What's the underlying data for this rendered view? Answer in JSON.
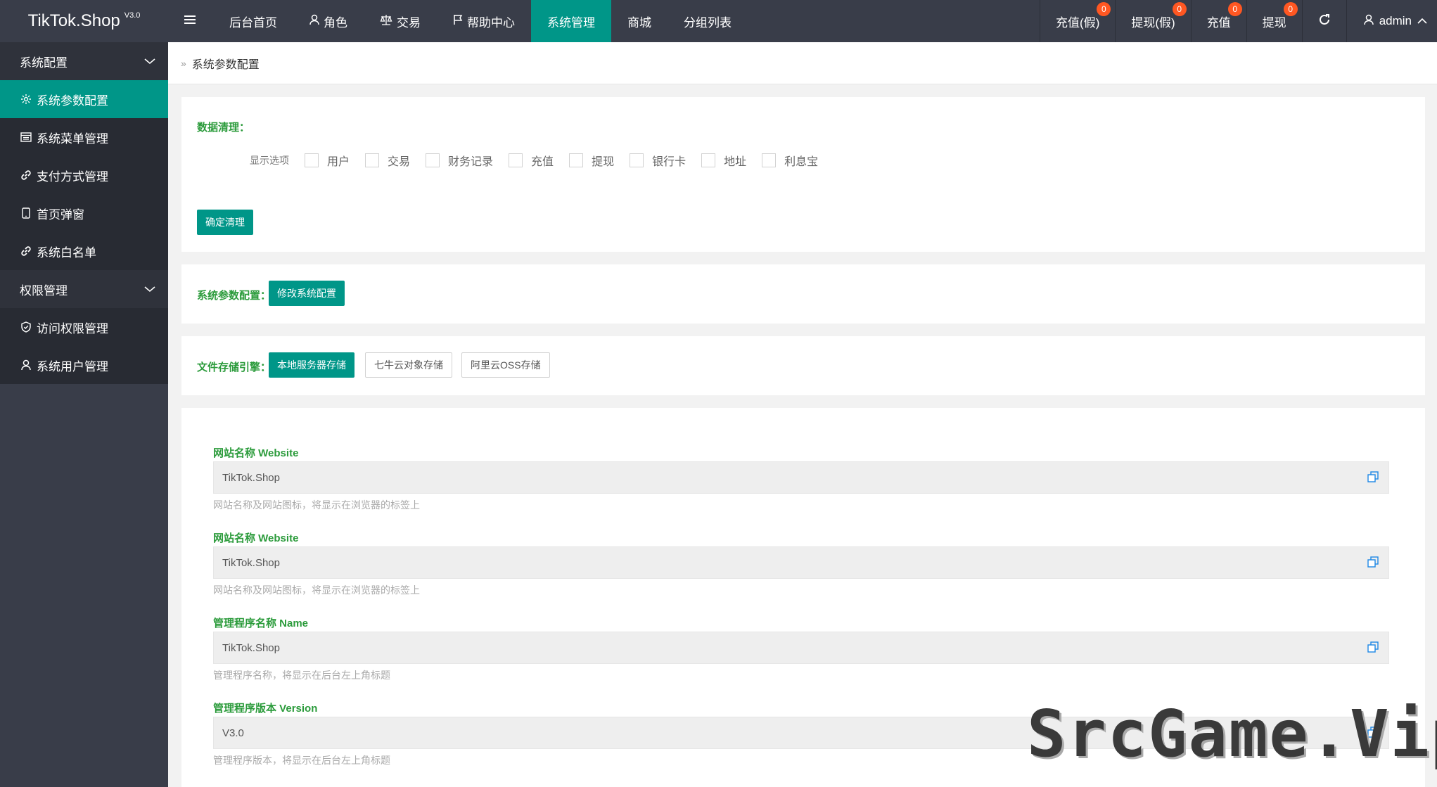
{
  "brand": {
    "name": "TikTok.Shop",
    "version": "V3.0"
  },
  "topnav": {
    "items": [
      {
        "label": "后台首页",
        "icon": ""
      },
      {
        "label": "角色",
        "icon": "user-icon"
      },
      {
        "label": "交易",
        "icon": "scale-icon"
      },
      {
        "label": "帮助中心",
        "icon": "flag-icon"
      },
      {
        "label": "系统管理",
        "icon": "",
        "active": true
      },
      {
        "label": "商城",
        "icon": ""
      },
      {
        "label": "分组列表",
        "icon": ""
      }
    ],
    "right": [
      {
        "label": "充值(假)",
        "badge": "0"
      },
      {
        "label": "提现(假)",
        "badge": "0"
      },
      {
        "label": "充值",
        "badge": "0"
      },
      {
        "label": "提现",
        "badge": "0"
      }
    ],
    "user": "admin"
  },
  "sidebar": {
    "groups": [
      {
        "label": "系统配置",
        "items": [
          {
            "label": "系统参数配置",
            "icon": "gear-icon",
            "active": true
          },
          {
            "label": "系统菜单管理",
            "icon": "window-icon"
          },
          {
            "label": "支付方式管理",
            "icon": "link-icon"
          },
          {
            "label": "首页弹窗",
            "icon": "phone-icon"
          },
          {
            "label": "系统白名单",
            "icon": "link-icon"
          }
        ]
      },
      {
        "label": "权限管理",
        "items": [
          {
            "label": "访问权限管理",
            "icon": "shield-icon"
          },
          {
            "label": "系统用户管理",
            "icon": "user-icon"
          }
        ]
      }
    ]
  },
  "breadcrumb": {
    "current": "系统参数配置"
  },
  "data_clean": {
    "title": "数据清理：",
    "display_label": "显示选项",
    "options": [
      "用户",
      "交易",
      "财务记录",
      "充值",
      "提现",
      "银行卡",
      "地址",
      "利息宝"
    ],
    "confirm_button": "确定清理"
  },
  "system_params": {
    "title": "系统参数配置：",
    "button": "修改系统配置"
  },
  "storage": {
    "title": "文件存储引擎：",
    "options": [
      "本地服务器存储",
      "七牛云对象存储",
      "阿里云OSS存储"
    ],
    "selected": "本地服务器存储"
  },
  "fields": [
    {
      "label": "网站名称 Website",
      "value": "TikTok.Shop",
      "help": "网站名称及网站图标，将显示在浏览器的标签上"
    },
    {
      "label": "网站名称 Website",
      "value": "TikTok.Shop",
      "help": "网站名称及网站图标，将显示在浏览器的标签上"
    },
    {
      "label": "管理程序名称 Name",
      "value": "TikTok.Shop",
      "help": "管理程序名称，将显示在后台左上角标题"
    },
    {
      "label": "管理程序版本 Version",
      "value": "V3.0",
      "help": "管理程序版本，将显示在后台左上角标题"
    }
  ],
  "watermark": "SrcGame.Vip",
  "colors": {
    "accent": "#009688",
    "header": "#393d49",
    "badge": "#ff5722",
    "label_green": "#2b9b3b"
  }
}
